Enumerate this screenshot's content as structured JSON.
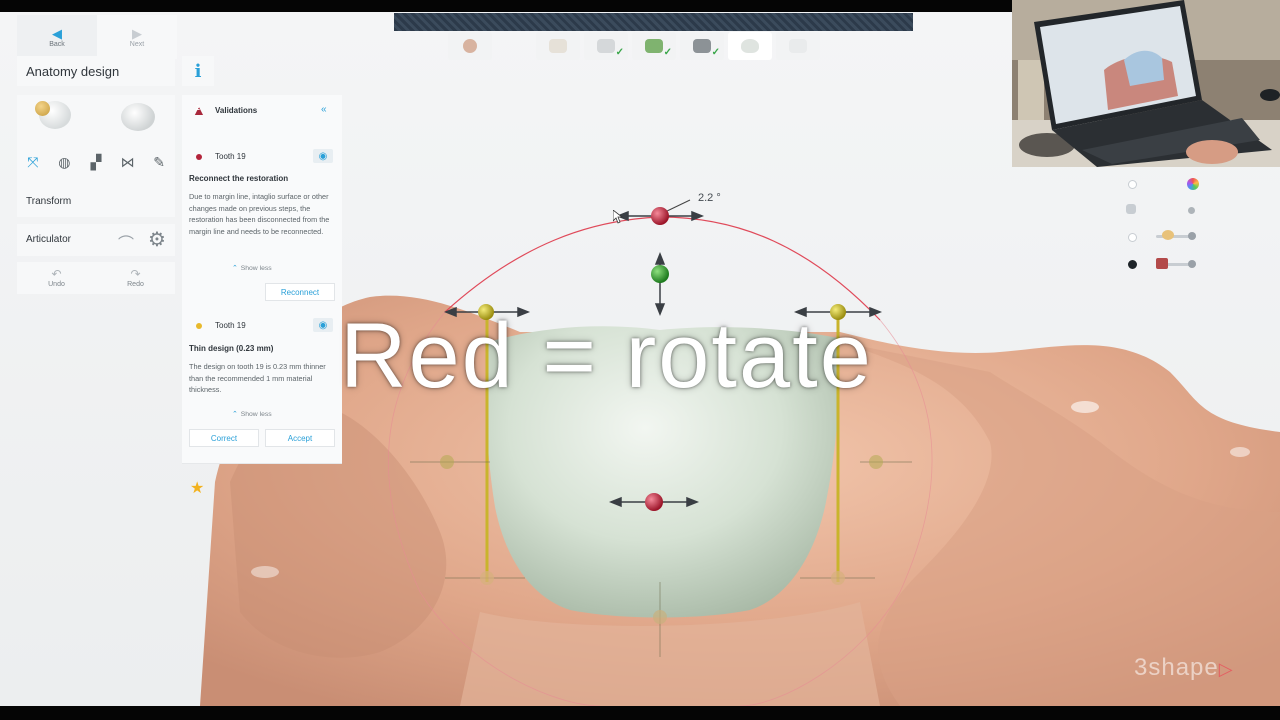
{
  "nav": {
    "back_label": "Back",
    "next_label": "Next"
  },
  "panel": {
    "title": "Anatomy design",
    "info_glyph": "i"
  },
  "tools": {
    "transform_label": "Transform",
    "articulator_label": "Articulator"
  },
  "history": {
    "undo_label": "Undo",
    "redo_label": "Redo"
  },
  "validations": {
    "title": "Validations",
    "count": "2",
    "collapse_glyph": "«",
    "items": [
      {
        "name": "Tooth 19",
        "severity_color": "#b3243b",
        "heading": "Reconnect the restoration",
        "body": "Due to margin line, intaglio surface or other changes made on previous steps, the restoration has been disconnected from the margin line and needs to be reconnected.",
        "show_less": "Show less",
        "action": "Reconnect"
      },
      {
        "name": "Tooth 19",
        "severity_color": "#e8b92c",
        "heading": "Thin design (0.23 mm)",
        "body": "The design on tooth 19 is 0.23 mm thinner than the recommended 1 mm material thickness.",
        "show_less": "Show less",
        "actions": [
          "Correct",
          "Accept"
        ]
      }
    ]
  },
  "overlay": {
    "caption": "Red = rotate",
    "angle_readout": "2.2 °"
  },
  "branding": {
    "logo_text": "3shape"
  },
  "colors": {
    "accent": "#2aa0d8",
    "error": "#b3243b",
    "warning": "#e8b92c",
    "favorite": "#f2b21f"
  }
}
